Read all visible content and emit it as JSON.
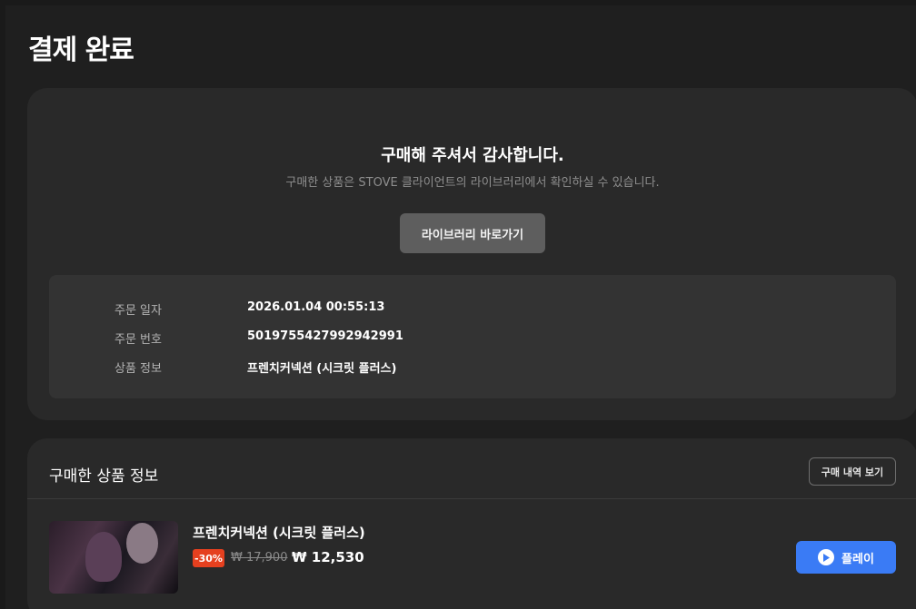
{
  "page": {
    "title": "결제 완료"
  },
  "completion": {
    "thanks": "구매해 주셔서 감사합니다.",
    "subtitle": "구매한 상품은 STOVE 클라이언트의 라이브러리에서 확인하실 수 있습니다.",
    "library_button": "라이브러리 바로가기"
  },
  "order_info": [
    {
      "label": "주문 일자",
      "value": "2026.01.04 00:55:13"
    },
    {
      "label": "주문 번호",
      "value": "5019755427992942991"
    },
    {
      "label": "상품 정보",
      "value": "프렌치커넥션 (시크릿 플러스)"
    }
  ],
  "purchased": {
    "heading": "구매한 상품 정보",
    "history_button": "구매 내역 보기",
    "items": [
      {
        "name": "프렌치커넥션 (시크릿 플러스)",
        "discount": "-30%",
        "original_price": "₩ 17,900",
        "final_price": "₩ 12,530",
        "play_button": "플레이",
        "thumbnail_icon": "game-cover-image"
      }
    ]
  },
  "colors": {
    "background": "#1f1f1f",
    "card": "#292929",
    "accent": "#3a7bf5",
    "discount": "#e5401f"
  }
}
